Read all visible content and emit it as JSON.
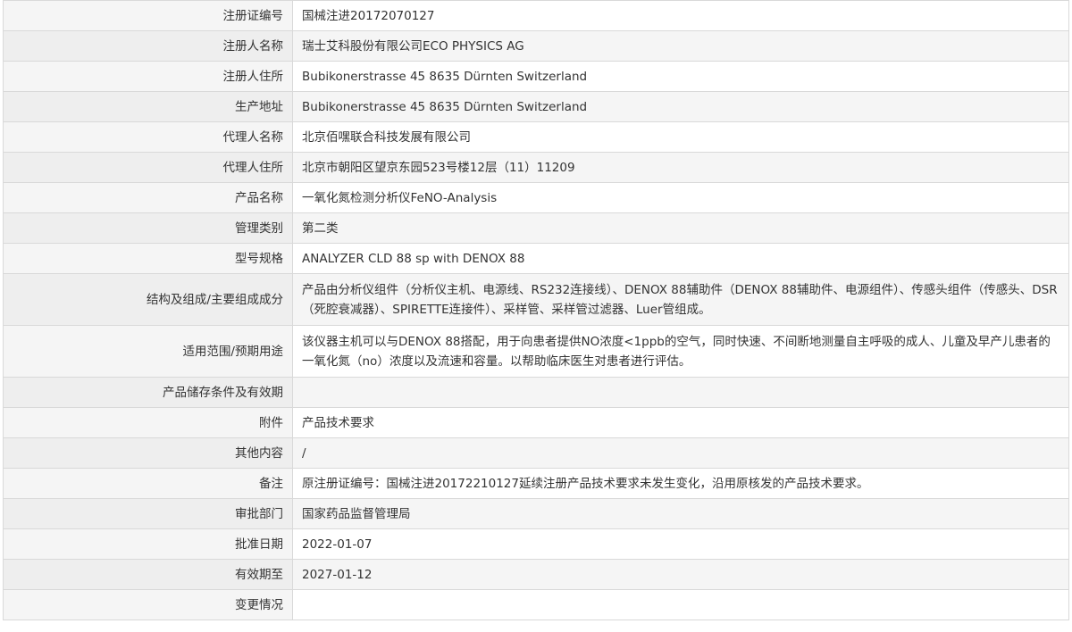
{
  "rows": [
    {
      "label": "注册证编号",
      "value": "国械注进20172070127"
    },
    {
      "label": "注册人名称",
      "value": "瑞士艾科股份有限公司ECO PHYSICS AG"
    },
    {
      "label": "注册人住所",
      "value": "Bubikonerstrasse 45 8635 Dürnten Switzerland"
    },
    {
      "label": "生产地址",
      "value": "Bubikonerstrasse 45 8635 Dürnten Switzerland"
    },
    {
      "label": "代理人名称",
      "value": "北京佰嘿联合科技发展有限公司"
    },
    {
      "label": "代理人住所",
      "value": "北京市朝阳区望京东园523号楼12层（11）11209"
    },
    {
      "label": "产品名称",
      "value": "一氧化氮检测分析仪FeNO-Analysis"
    },
    {
      "label": "管理类别",
      "value": "第二类"
    },
    {
      "label": "型号规格",
      "value": "ANALYZER CLD 88 sp with DENOX 88"
    },
    {
      "label": "结构及组成/主要组成成分",
      "value": "产品由分析仪组件（分析仪主机、电源线、RS232连接线）、DENOX 88辅助件（DENOX 88辅助件、电源组件）、传感头组件（传感头、DSR（死腔衰减器）、SPIRETTE连接件）、采样管、采样管过滤器、Luer管组成。"
    },
    {
      "label": "适用范围/预期用途",
      "value": "该仪器主机可以与DENOX 88搭配，用于向患者提供NO浓度<1ppb的空气，同时快速、不间断地测量自主呼吸的成人、儿童及早产儿患者的一氧化氮（no）浓度以及流速和容量。以帮助临床医生对患者进行评估。"
    },
    {
      "label": "产品储存条件及有效期",
      "value": ""
    },
    {
      "label": "附件",
      "value": "产品技术要求"
    },
    {
      "label": "其他内容",
      "value": "/"
    },
    {
      "label": "备注",
      "value": "原注册证编号：国械注进20172210127延续注册产品技术要求未发生变化，沿用原核发的产品技术要求。"
    },
    {
      "label": "审批部门",
      "value": "国家药品监督管理局"
    },
    {
      "label": "批准日期",
      "value": "2022-01-07"
    },
    {
      "label": "有效期至",
      "value": "2027-01-12"
    },
    {
      "label": "变更情况",
      "value": ""
    }
  ]
}
